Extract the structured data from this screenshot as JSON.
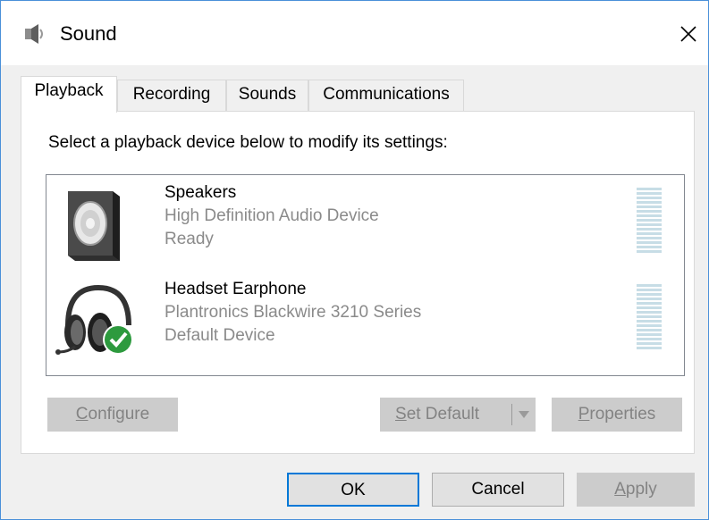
{
  "window": {
    "title": "Sound",
    "close_symbol": "✕"
  },
  "tabs": [
    {
      "label": "Playback",
      "active": true
    },
    {
      "label": "Recording",
      "active": false
    },
    {
      "label": "Sounds",
      "active": false
    },
    {
      "label": "Communications",
      "active": false
    }
  ],
  "playback": {
    "instruction": "Select a playback device below to modify its settings:",
    "devices": [
      {
        "name": "Speakers",
        "description": "High Definition Audio Device",
        "status": "Ready",
        "icon": "speaker-icon"
      },
      {
        "name": "Headset Earphone",
        "description": "Plantronics Blackwire 3210 Series",
        "status": "Default Device",
        "icon": "headset-icon",
        "badge_icon": "default-check-icon"
      }
    ],
    "buttons": {
      "configure": {
        "underline": "C",
        "rest": "onfigure"
      },
      "set_default": {
        "underline": "S",
        "rest": "et Default"
      },
      "properties": {
        "underline": "P",
        "rest": "roperties"
      }
    }
  },
  "footer": {
    "ok": "OK",
    "cancel": "Cancel",
    "apply_underline": "A",
    "apply_rest": "pply"
  },
  "colors": {
    "accent": "#0078d7",
    "check_badge": "#2d9a3e",
    "meter_bar": "#c7dde6",
    "window_border": "#4a90d9"
  }
}
